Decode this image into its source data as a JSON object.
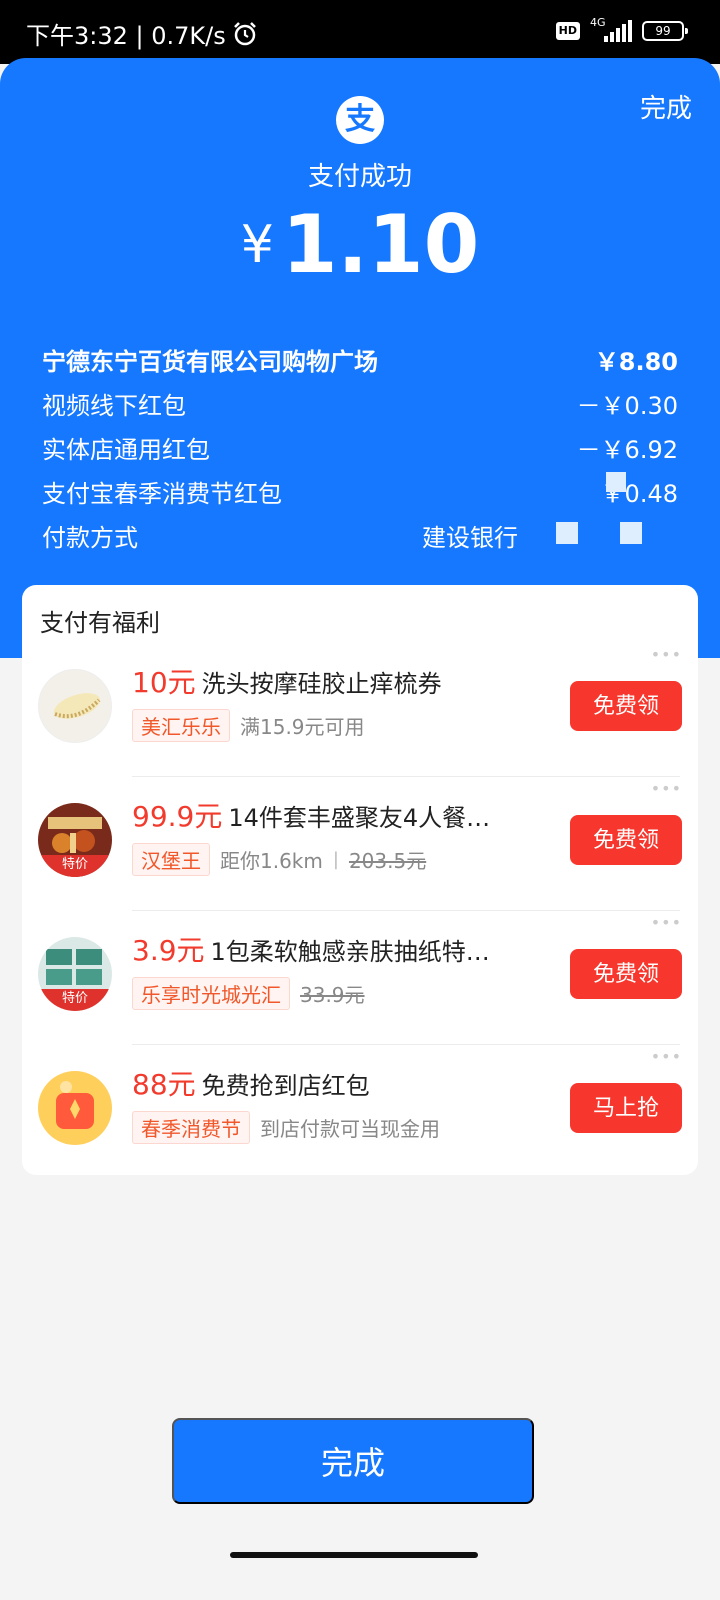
{
  "status_bar": {
    "left_text": "下午3:32 | 0.7K/s",
    "hd": "HD",
    "network": "4G",
    "battery": "99"
  },
  "header": {
    "done_label": "完成",
    "logo_char": "支",
    "success_text": "支付成功",
    "currency": "¥",
    "amount": "1.10"
  },
  "details": {
    "merchant": {
      "label": "宁德东宁百货有限公司购物广场",
      "value": "￥8.80"
    },
    "rows": [
      {
        "label": "视频线下红包",
        "value": "－￥0.30"
      },
      {
        "label": "实体店通用红包",
        "value": "－￥6.92"
      },
      {
        "label": "支付宝春季消费节红包",
        "value": "￥0.48"
      }
    ],
    "payment": {
      "label": "付款方式",
      "value": "建设银行"
    }
  },
  "benefits": {
    "title": "支付有福利",
    "items": [
      {
        "price": "10元",
        "title": "洗头按摩硅胶止痒梳券",
        "tag": "美汇乐乐",
        "sub": "满15.9元可用",
        "button": "免费领",
        "thumb_icon": "comb-icon"
      },
      {
        "price": "99.9元",
        "title": "14件套丰盛聚友4人餐…",
        "tag": "汉堡王",
        "sub": "距你1.6km",
        "sep": "|",
        "strike": "203.5元",
        "button": "免费领",
        "thumb_tag": "特价",
        "thumb_icon": "burger-meal-icon"
      },
      {
        "price": "3.9元",
        "title": "1包柔软触感亲肤抽纸特…",
        "tag": "乐享时光城光汇",
        "strike": "33.9元",
        "button": "免费领",
        "thumb_tag": "特价",
        "thumb_icon": "tissue-box-icon"
      },
      {
        "price": "88元",
        "title": "免费抢到店红包",
        "tag": "春季消费节",
        "sub": "到店付款可当现金用",
        "button": "马上抢",
        "thumb_icon": "red-packet-icon"
      }
    ]
  },
  "footer": {
    "done_label": "完成"
  },
  "colors": {
    "brand_blue": "#1678ff",
    "accent_red": "#f7372d"
  }
}
